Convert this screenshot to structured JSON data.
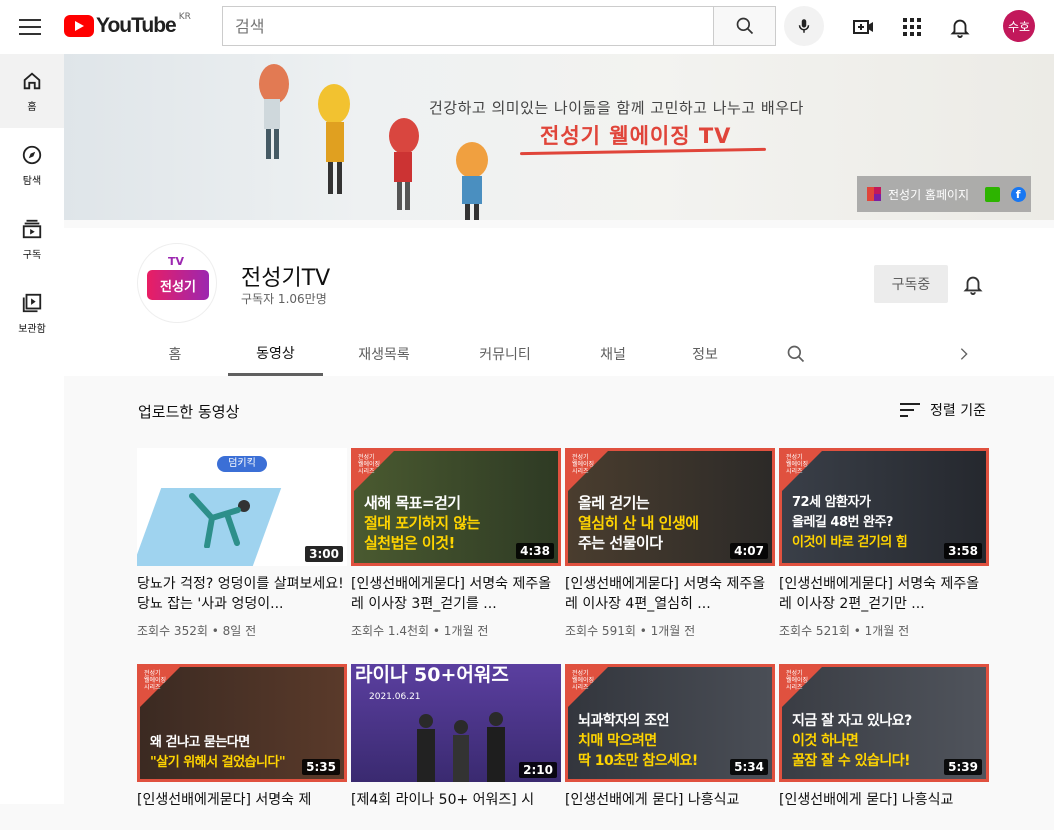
{
  "header": {
    "logo_text": "YouTube",
    "region": "KR",
    "search_placeholder": "검색",
    "avatar_text": "수호"
  },
  "sidebar": {
    "items": [
      {
        "label": "홈",
        "icon": "home-icon"
      },
      {
        "label": "탐색",
        "icon": "compass-icon"
      },
      {
        "label": "구독",
        "icon": "subscriptions-icon"
      },
      {
        "label": "보관함",
        "icon": "library-icon"
      }
    ]
  },
  "banner": {
    "tagline": "건강하고 의미있는 나이듦을 함께 고민하고 나누고 배우다",
    "title": "전성기 웰에이징 TV",
    "home_link": "전성기 홈페이지"
  },
  "channel": {
    "name": "전성기TV",
    "subscribers": "구독자 1.06만명",
    "subscribe_label": "구독중",
    "avatar_text": "전성기",
    "avatar_tv": "TV"
  },
  "tabs": [
    "홈",
    "동영상",
    "재생목록",
    "커뮤니티",
    "채널",
    "정보"
  ],
  "active_tab": "동영상",
  "section": {
    "title": "업로드한 동영상",
    "sort_label": "정렬 기준"
  },
  "videos": [
    {
      "title": "당뇨가 걱정? 엉덩이를 살펴보세요! 당뇨 잡는 '사과 엉덩이...",
      "meta": "조회수 352회 • 8일 전",
      "duration": "3:00",
      "thumb_lines": [
        "덤키킥"
      ]
    },
    {
      "title": "[인생선배에게묻다] 서명숙 제주올레 이사장 3편_걷기를 ...",
      "meta": "조회수 1.4천회 • 1개월 전",
      "duration": "4:38",
      "thumb_lines": [
        "새해 목표=걷기",
        "절대 포기하지 않는",
        "실천법은 이것!"
      ]
    },
    {
      "title": "[인생선배에게묻다] 서명숙 제주올레 이사장 4편_열심히 ...",
      "meta": "조회수 591회 • 1개월 전",
      "duration": "4:07",
      "thumb_lines": [
        "올레 걷기는",
        "열심히 산 내 인생에",
        "주는 선물이다"
      ]
    },
    {
      "title": "[인생선배에게묻다] 서명숙 제주올레 이사장 2편_걷기만 ...",
      "meta": "조회수 521회 • 1개월 전",
      "duration": "3:58",
      "thumb_lines": [
        "72세 암환자가",
        "올레길 48번 완주?",
        "이것이 바로 걷기의 힘"
      ]
    },
    {
      "title": "[인생선배에게묻다] 서명숙 제",
      "meta": "",
      "duration": "5:35",
      "thumb_lines": [
        "왜 걷냐고 묻는다면",
        "\"살기 위해서 걸었습니다\""
      ]
    },
    {
      "title": "[제4회 라이나 50+ 어워즈] 시",
      "meta": "",
      "duration": "2:10",
      "thumb_lines": [
        "라이나 50+어워즈",
        "2021.06.21"
      ]
    },
    {
      "title": "[인생선배에게 묻다] 나흥식교",
      "meta": "",
      "duration": "5:34",
      "thumb_lines": [
        "뇌과학자의 조언",
        "치매 막으려면",
        "딱 10초만 참으세요!"
      ]
    },
    {
      "title": "[인생선배에게 묻다] 나흥식교",
      "meta": "",
      "duration": "5:39",
      "thumb_lines": [
        "지금 잘 자고 있나요?",
        "이것 하나면",
        "꿀잠 잘 수 있습니다!"
      ]
    }
  ],
  "thumb_badge": [
    "전성기",
    "웰에이징",
    "시리즈"
  ],
  "colors": {
    "brand_red": "#ff0000",
    "accent_orange": "#e0513f",
    "highlight_yellow": "#ffd400",
    "avatar_pink": "#c2185b"
  }
}
